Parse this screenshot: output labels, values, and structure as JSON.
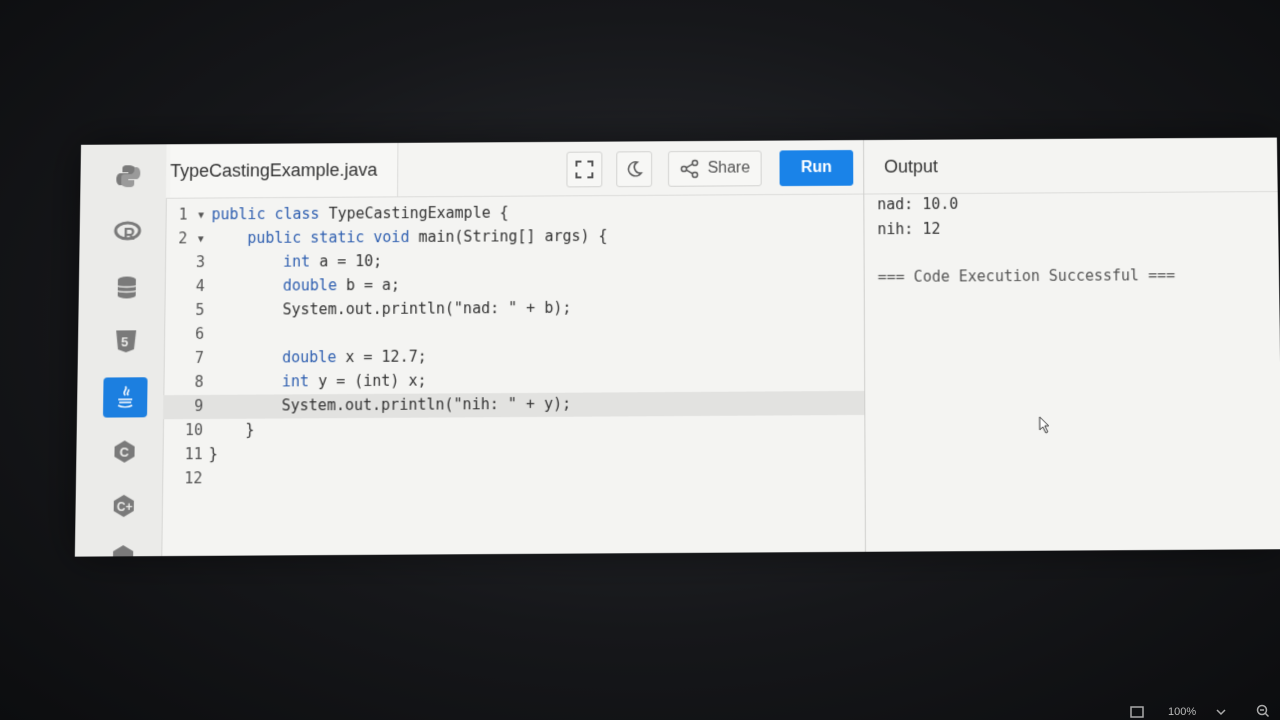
{
  "editor": {
    "filename": "TypeCastingExample.java",
    "lines": [
      {
        "num": "1",
        "fold": "▾",
        "indent": "",
        "tokens": [
          [
            "kw",
            "public class "
          ],
          [
            "",
            "TypeCastingExample {"
          ]
        ]
      },
      {
        "num": "2",
        "fold": "▾",
        "indent": "    ",
        "tokens": [
          [
            "kw",
            "public static void "
          ],
          [
            "",
            "main(String[] args) {"
          ]
        ]
      },
      {
        "num": "3",
        "fold": "",
        "indent": "        ",
        "tokens": [
          [
            "kw",
            "int "
          ],
          [
            "",
            "a = 10;"
          ]
        ]
      },
      {
        "num": "4",
        "fold": "",
        "indent": "        ",
        "tokens": [
          [
            "kw",
            "double "
          ],
          [
            "",
            "b = a;"
          ]
        ]
      },
      {
        "num": "5",
        "fold": "",
        "indent": "        ",
        "tokens": [
          [
            "",
            "System.out.println(\"nad: \" + b);"
          ]
        ]
      },
      {
        "num": "6",
        "fold": "",
        "indent": "",
        "tokens": [
          [
            "",
            ""
          ]
        ]
      },
      {
        "num": "7",
        "fold": "",
        "indent": "        ",
        "tokens": [
          [
            "kw",
            "double "
          ],
          [
            "",
            "x = 12.7;"
          ]
        ]
      },
      {
        "num": "8",
        "fold": "",
        "indent": "        ",
        "tokens": [
          [
            "kw",
            "int "
          ],
          [
            "",
            "y = (int) x;"
          ]
        ]
      },
      {
        "num": "9",
        "fold": "",
        "indent": "        ",
        "tokens": [
          [
            "",
            "System.out.println(\"nih: \" + y);"
          ]
        ]
      },
      {
        "num": "10",
        "fold": "",
        "indent": "    ",
        "tokens": [
          [
            "",
            "}"
          ]
        ]
      },
      {
        "num": "11",
        "fold": "",
        "indent": "",
        "tokens": [
          [
            "",
            "}"
          ]
        ]
      },
      {
        "num": "12",
        "fold": "",
        "indent": "",
        "tokens": [
          [
            "",
            ""
          ]
        ]
      }
    ],
    "active_line": "9"
  },
  "toolbar": {
    "share_label": "Share",
    "run_label": "Run",
    "fullscreen_icon": "fullscreen-icon",
    "theme_icon": "moon-icon",
    "share_icon": "share-icon"
  },
  "sidebar": {
    "languages": [
      "python-icon",
      "r-icon",
      "database-icon",
      "html5-icon",
      "java-icon",
      "c-icon",
      "cpp-icon",
      "csharp-icon"
    ],
    "active": "java-icon"
  },
  "output": {
    "title": "Output",
    "lines": [
      "nad: 10.0",
      "nih: 12",
      "",
      "=== Code Execution Successful ==="
    ]
  },
  "taskbar": {
    "zoom": "100%"
  },
  "colors": {
    "accent": "#1a83e8",
    "keyword": "#2f5fb0"
  }
}
